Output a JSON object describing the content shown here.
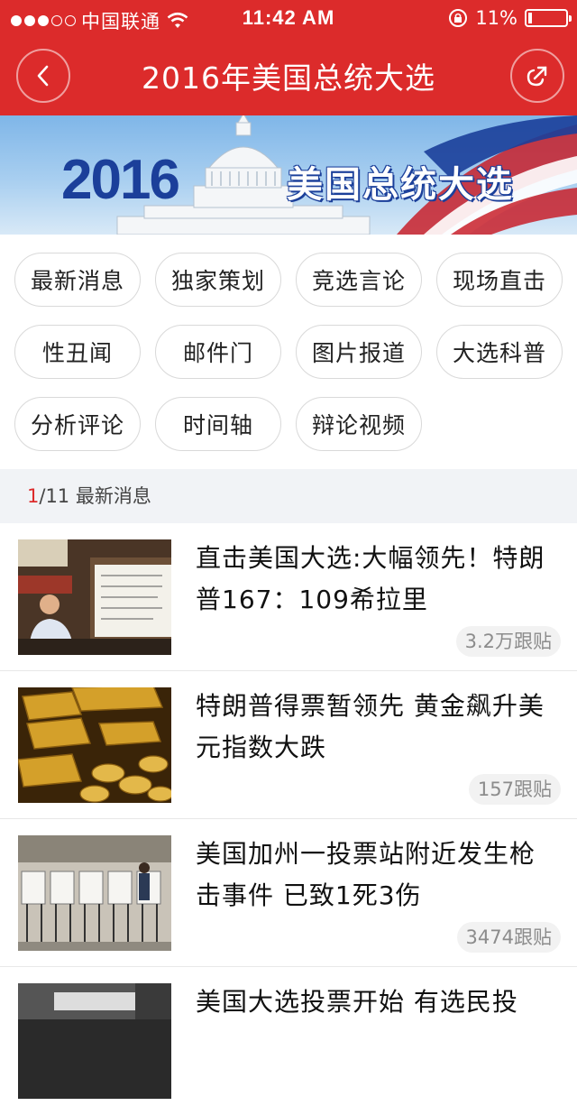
{
  "status_bar": {
    "carrier": "中国联通",
    "time": "11:42 AM",
    "battery": "11%",
    "battery_level": 0.11,
    "signal_bars": 3
  },
  "header": {
    "title": "2016年美国总统大选",
    "back_icon": "chevron-left-icon",
    "share_icon": "share-icon"
  },
  "banner": {
    "year": "2016",
    "title": "美国总统大选"
  },
  "tags": [
    {
      "label": "最新消息"
    },
    {
      "label": "独家策划"
    },
    {
      "label": "竞选言论"
    },
    {
      "label": "现场直击"
    },
    {
      "label": "性丑闻"
    },
    {
      "label": "邮件门"
    },
    {
      "label": "图片报道"
    },
    {
      "label": "大选科普"
    },
    {
      "label": "分析评论"
    },
    {
      "label": "时间轴"
    },
    {
      "label": "辩论视频"
    }
  ],
  "section": {
    "current": "1",
    "total": "/11",
    "name": "最新消息"
  },
  "news": [
    {
      "title": "直击美国大选:大幅领先！特朗普167：109希拉里",
      "comments": "3.2万跟贴"
    },
    {
      "title": "特朗普得票暂领先 黄金飙升美元指数大跌",
      "comments": "157跟贴"
    },
    {
      "title": "美国加州一投票站附近发生枪击事件 已致1死3伤",
      "comments": "3474跟贴"
    },
    {
      "title": "美国大选投票开始 有选民投",
      "comments": ""
    }
  ],
  "colors": {
    "brand_red": "#dc2b2b",
    "banner_blue": "#1b3f9a"
  }
}
